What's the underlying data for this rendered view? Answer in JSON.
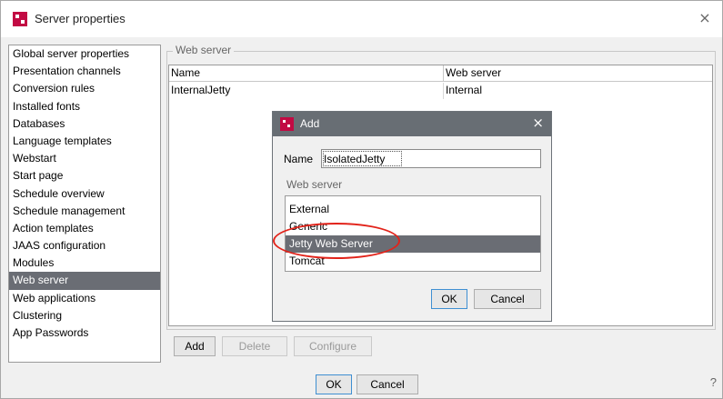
{
  "window": {
    "title": "Server properties",
    "close": "×",
    "help": "?"
  },
  "sidebar": {
    "items": [
      {
        "label": "Global server properties"
      },
      {
        "label": "Presentation channels"
      },
      {
        "label": "Conversion rules"
      },
      {
        "label": "Installed fonts"
      },
      {
        "label": "Databases"
      },
      {
        "label": "Language templates"
      },
      {
        "label": "Webstart"
      },
      {
        "label": "Start page"
      },
      {
        "label": "Schedule overview"
      },
      {
        "label": "Schedule management"
      },
      {
        "label": "Action templates"
      },
      {
        "label": "JAAS configuration"
      },
      {
        "label": "Modules"
      },
      {
        "label": "Web server",
        "selected": true
      },
      {
        "label": "Web applications"
      },
      {
        "label": "Clustering"
      },
      {
        "label": "App Passwords"
      }
    ]
  },
  "main": {
    "group_title": "Web server",
    "table": {
      "columns": [
        "Name",
        "Web server"
      ],
      "rows": [
        [
          "InternalJetty",
          "Internal"
        ]
      ]
    },
    "buttons": {
      "add": "Add",
      "delete": "Delete",
      "configure": "Configure"
    }
  },
  "footer": {
    "ok": "OK",
    "cancel": "Cancel"
  },
  "dialog": {
    "title": "Add",
    "close": "×",
    "name_label": "Name",
    "name_value": "IsolatedJetty",
    "web_server_label": "Web server",
    "options": [
      "External",
      "Generic",
      "Jetty Web Server",
      "Tomcat"
    ],
    "selected_option": "Jetty Web Server",
    "ok": "OK",
    "cancel": "Cancel"
  },
  "annotation": {
    "color": "#e2231a"
  },
  "colors": {
    "selection": "#6a6d74",
    "dialog_title_bar": "#686e74",
    "logo": "#c20a43"
  }
}
